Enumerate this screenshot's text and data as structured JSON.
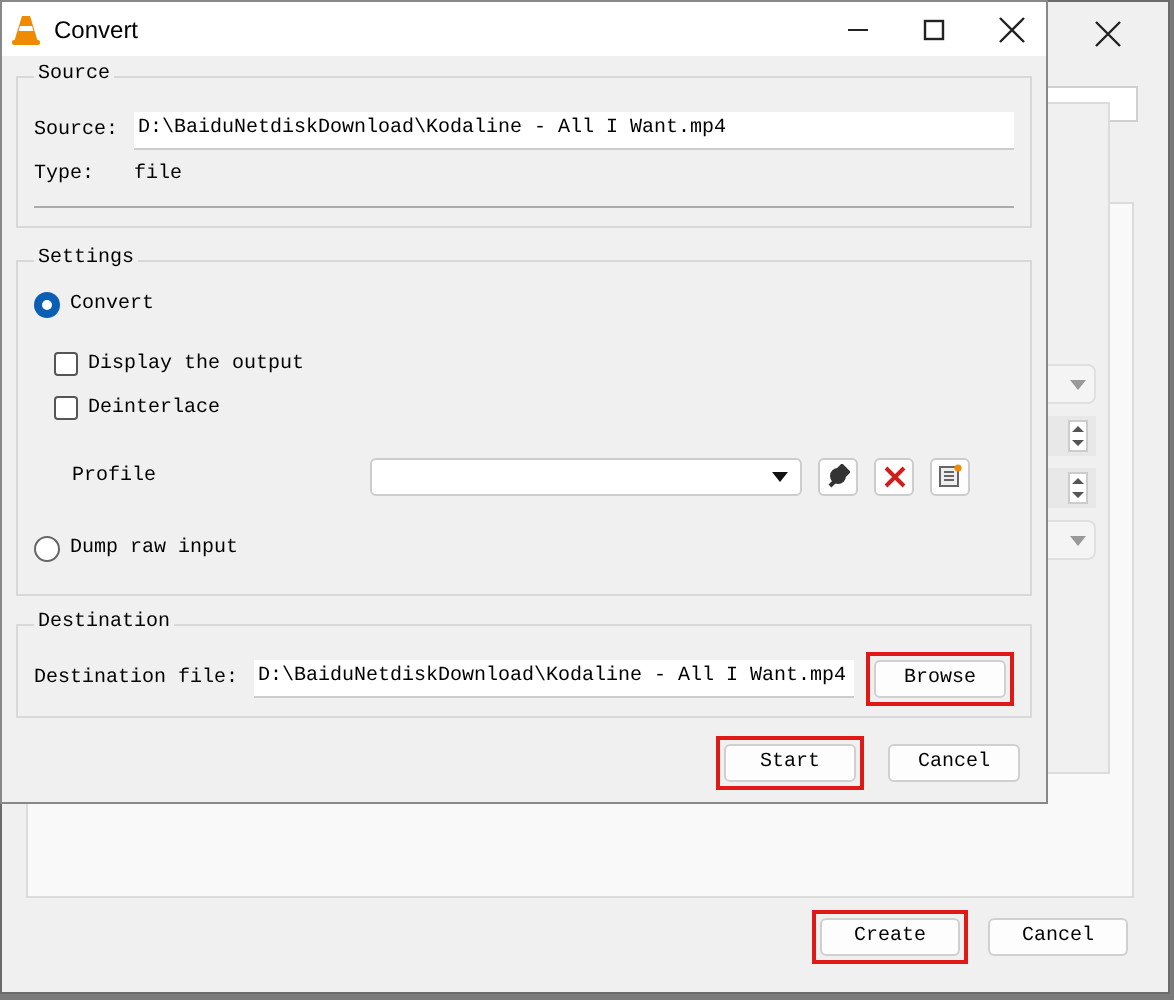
{
  "background_window": {
    "buttons": [
      {
        "label": "Create",
        "highlighted": true
      },
      {
        "label": "Cancel",
        "highlighted": false
      }
    ]
  },
  "dialog": {
    "title": "Convert",
    "source": {
      "heading": "Source",
      "source_label": "Source:",
      "source_value": "D:\\BaiduNetdiskDownload\\Kodaline - All I Want.mp4",
      "type_label": "Type:",
      "type_value": "file"
    },
    "settings": {
      "heading": "Settings",
      "items": [
        {
          "kind": "radio",
          "label": "Convert",
          "selected": true
        },
        {
          "kind": "checkbox",
          "label": "Display the output",
          "checked": false
        },
        {
          "kind": "checkbox",
          "label": "Deinterlace",
          "checked": false
        },
        {
          "kind": "profile",
          "label": "Profile"
        },
        {
          "kind": "radio",
          "label": "Dump raw input",
          "selected": false
        }
      ]
    },
    "destination": {
      "heading": "Destination",
      "label": "Destination file:",
      "value": "D:\\BaiduNetdiskDownload\\Kodaline - All I Want.mp4",
      "browse": {
        "label": "Browse",
        "highlighted": true
      }
    },
    "buttons": [
      {
        "label": "Start",
        "highlighted": true
      },
      {
        "label": "Cancel",
        "highlighted": false
      }
    ]
  }
}
